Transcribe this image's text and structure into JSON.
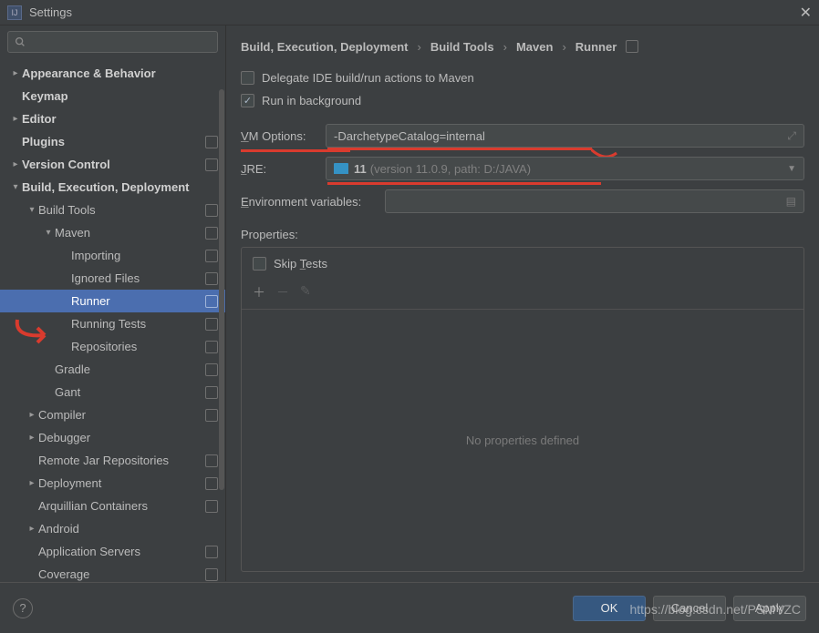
{
  "window": {
    "title": "Settings",
    "app_icon_letter": "IJ"
  },
  "sidebar": {
    "search_placeholder": "",
    "items": [
      {
        "label": "Appearance & Behavior",
        "level": 0,
        "bold": true,
        "arrow": "right",
        "badge": false
      },
      {
        "label": "Keymap",
        "level": 0,
        "bold": true,
        "arrow": "",
        "badge": false
      },
      {
        "label": "Editor",
        "level": 0,
        "bold": true,
        "arrow": "right",
        "badge": false
      },
      {
        "label": "Plugins",
        "level": 0,
        "bold": true,
        "arrow": "",
        "badge": true
      },
      {
        "label": "Version Control",
        "level": 0,
        "bold": true,
        "arrow": "right",
        "badge": true
      },
      {
        "label": "Build, Execution, Deployment",
        "level": 0,
        "bold": true,
        "arrow": "down",
        "badge": false
      },
      {
        "label": "Build Tools",
        "level": 1,
        "bold": false,
        "arrow": "down",
        "badge": true
      },
      {
        "label": "Maven",
        "level": 2,
        "bold": false,
        "arrow": "down",
        "badge": true
      },
      {
        "label": "Importing",
        "level": 3,
        "bold": false,
        "arrow": "",
        "badge": true
      },
      {
        "label": "Ignored Files",
        "level": 3,
        "bold": false,
        "arrow": "",
        "badge": true
      },
      {
        "label": "Runner",
        "level": 3,
        "bold": false,
        "arrow": "",
        "badge": true,
        "selected": true
      },
      {
        "label": "Running Tests",
        "level": 3,
        "bold": false,
        "arrow": "",
        "badge": true
      },
      {
        "label": "Repositories",
        "level": 3,
        "bold": false,
        "arrow": "",
        "badge": true
      },
      {
        "label": "Gradle",
        "level": 2,
        "bold": false,
        "arrow": "",
        "badge": true
      },
      {
        "label": "Gant",
        "level": 2,
        "bold": false,
        "arrow": "",
        "badge": true
      },
      {
        "label": "Compiler",
        "level": 1,
        "bold": false,
        "arrow": "right",
        "badge": true
      },
      {
        "label": "Debugger",
        "level": 1,
        "bold": false,
        "arrow": "right",
        "badge": false
      },
      {
        "label": "Remote Jar Repositories",
        "level": 1,
        "bold": false,
        "arrow": "",
        "badge": true
      },
      {
        "label": "Deployment",
        "level": 1,
        "bold": false,
        "arrow": "right",
        "badge": true
      },
      {
        "label": "Arquillian Containers",
        "level": 1,
        "bold": false,
        "arrow": "",
        "badge": true
      },
      {
        "label": "Android",
        "level": 1,
        "bold": false,
        "arrow": "right",
        "badge": false
      },
      {
        "label": "Application Servers",
        "level": 1,
        "bold": false,
        "arrow": "",
        "badge": true
      },
      {
        "label": "Coverage",
        "level": 1,
        "bold": false,
        "arrow": "",
        "badge": true
      }
    ]
  },
  "breadcrumb": {
    "parts": [
      "Build, Execution, Deployment",
      "Build Tools",
      "Maven",
      "Runner"
    ]
  },
  "form": {
    "delegate_label": "Delegate IDE build/run actions to Maven",
    "delegate_checked": false,
    "background_label": "Run in background",
    "background_checked": true,
    "vm_label": "VM Options:",
    "vm_value": "-DarchetypeCatalog=internal",
    "jre_label": "JRE:",
    "jre_value": "11",
    "jre_hint": "(version 11.0.9, path: D:/JAVA)",
    "env_label": "Environment variables:",
    "env_value": "",
    "props_label": "Properties:",
    "skip_tests_label": "Skip Tests",
    "skip_tests_checked": false,
    "props_empty": "No properties defined"
  },
  "footer": {
    "ok": "OK",
    "cancel": "Cancel",
    "apply": "Apply"
  },
  "watermark": "https://blog.csdn.net/PSMYZC"
}
